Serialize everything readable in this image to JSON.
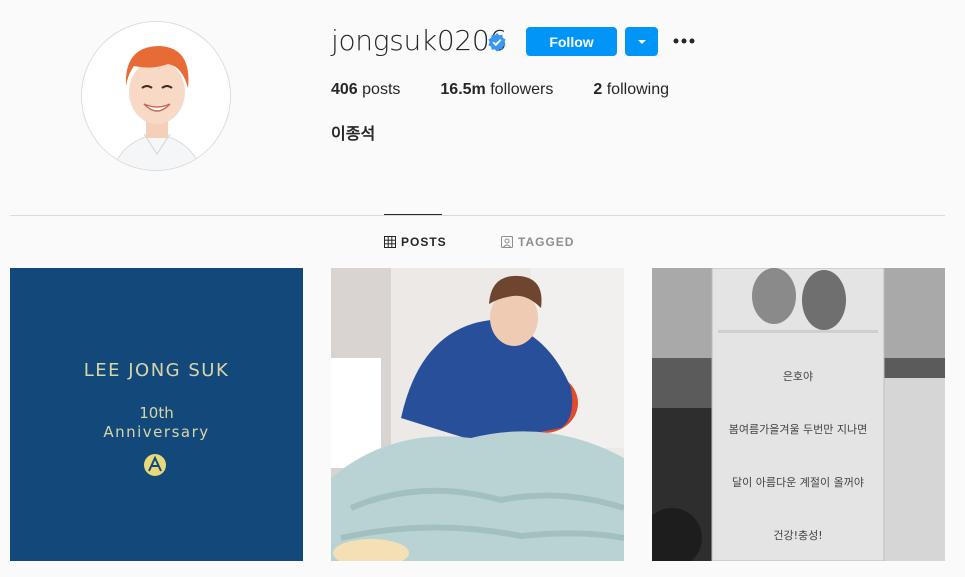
{
  "profile": {
    "username": "jongsuk0206",
    "full_name": "이종석",
    "verified": true
  },
  "actions": {
    "follow_label": "Follow",
    "dropdown_icon": "chevron-down-icon",
    "more_icon": "more-horizontal-icon"
  },
  "stats": {
    "posts_count": "406",
    "posts_label": "posts",
    "followers_count": "16.5m",
    "followers_label": "followers",
    "following_count": "2",
    "following_label": "following"
  },
  "tabs": [
    {
      "label": "POSTS",
      "icon": "grid-icon",
      "active": true
    },
    {
      "label": "TAGGED",
      "icon": "tag-icon",
      "active": false
    }
  ],
  "posts": [
    {
      "title": "LEE JONG SUK",
      "subtitle_num": "10th",
      "subtitle": "Anniversary"
    },
    {},
    {
      "lines": [
        "은호야",
        "봄여름가을겨울 두번만 지나면",
        "달이 아름다운 계절이 올꺼야",
        "건강!충성!"
      ]
    }
  ],
  "colors": {
    "accent": "#0095f6",
    "post1_bg": "#12497a"
  }
}
